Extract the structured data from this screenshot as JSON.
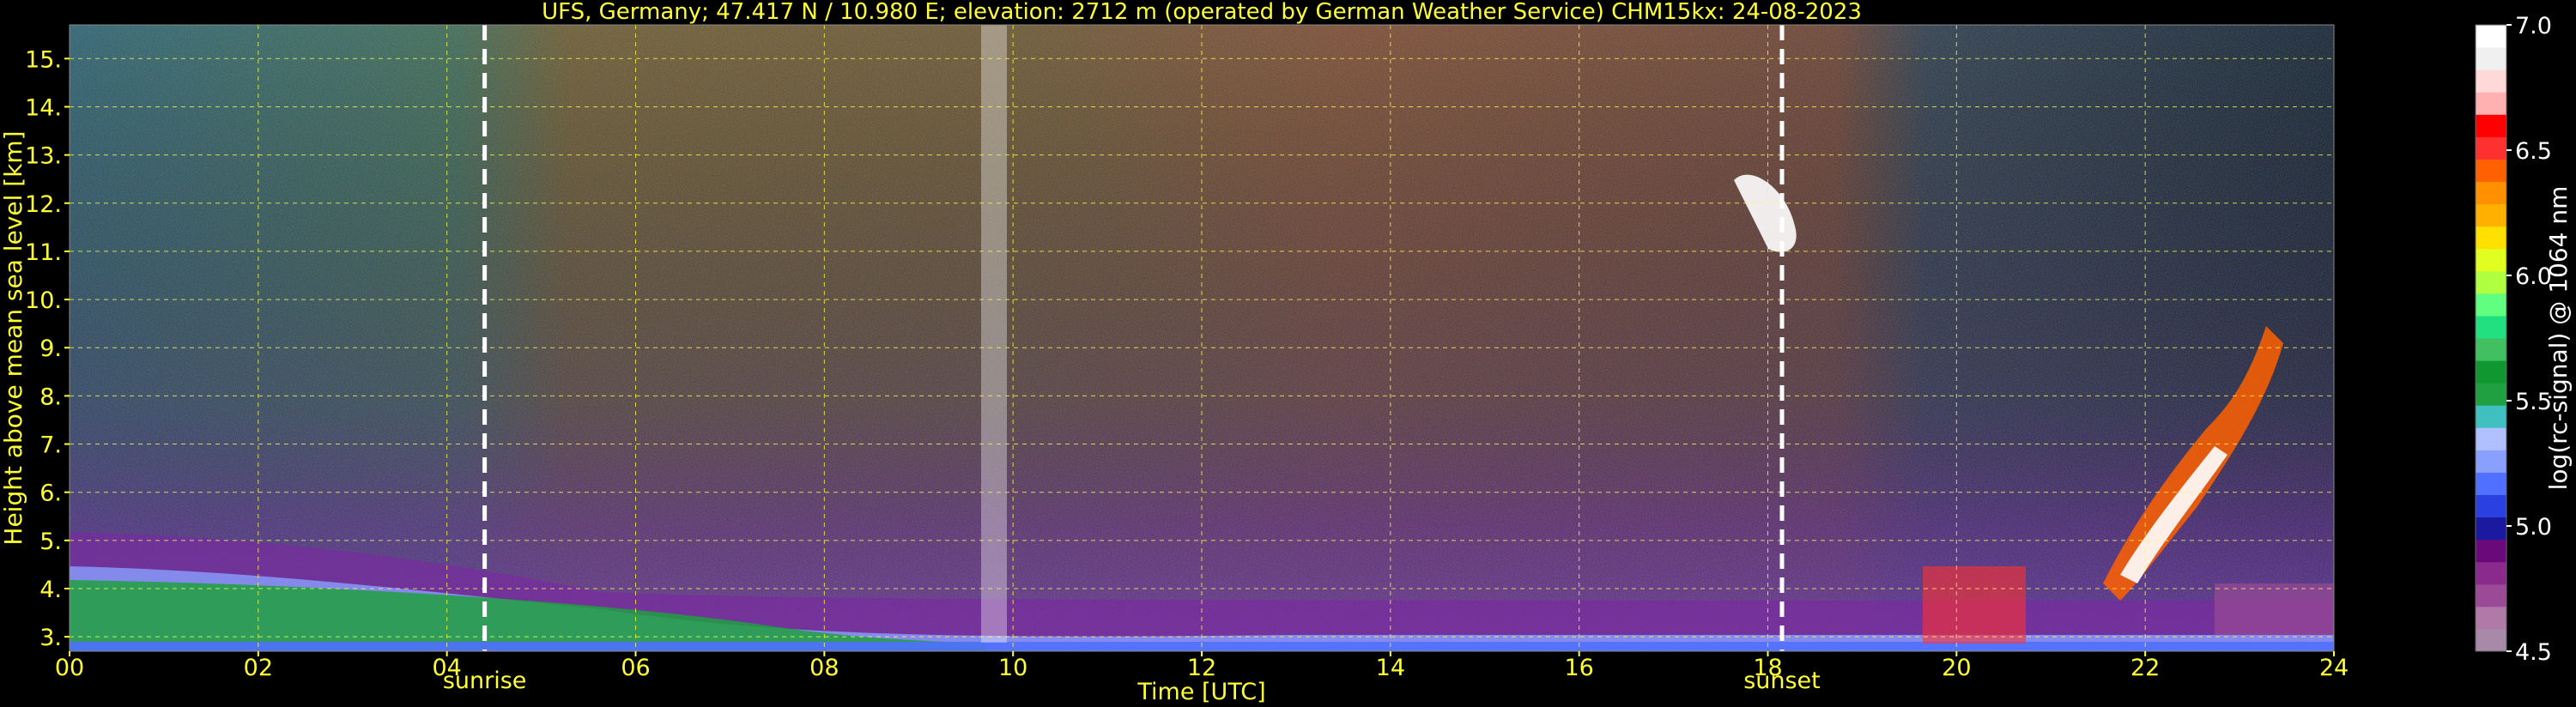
{
  "chart_data": {
    "type": "heatmap",
    "title": "UFS, Germany; 47.417 N / 10.980 E; elevation: 2712 m  (operated by German Weather Service)    CHM15kx: 24-08-2023",
    "xlabel": "Time [UTC]",
    "ylabel": "Height above mean sea level [km]",
    "xlim": [
      0,
      24
    ],
    "ylim": [
      2.7,
      15.7
    ],
    "x_ticks": [
      0,
      2,
      4,
      6,
      8,
      10,
      12,
      14,
      16,
      18,
      20,
      22,
      24
    ],
    "x_tick_labels": [
      "00",
      "02",
      "04",
      "06",
      "08",
      "10",
      "12",
      "14",
      "16",
      "18",
      "20",
      "22",
      "24"
    ],
    "y_ticks": [
      3,
      4,
      5,
      6,
      7,
      8,
      9,
      10,
      11,
      12,
      13,
      14,
      15
    ],
    "y_tick_labels": [
      "3.",
      "4.",
      "5.",
      "6.",
      "7.",
      "8.",
      "9.",
      "10.",
      "11.",
      "12.",
      "13.",
      "14.",
      "15."
    ],
    "grid": true,
    "markers": [
      {
        "label": "sunrise",
        "x": 4.4
      },
      {
        "label": "sunset",
        "x": 18.15
      }
    ],
    "colorbar": {
      "label": "log(rc-signal) @ 1064 nm",
      "min": 4.5,
      "max": 7.0,
      "ticks": [
        4.5,
        5.0,
        5.5,
        6.0,
        6.5,
        7.0
      ],
      "tick_labels": [
        "4.5",
        "5.0",
        "5.5",
        "6.0",
        "6.5",
        "7.0"
      ],
      "colors": [
        "#a88aa8",
        "#b07aa8",
        "#9a4a96",
        "#8a2a8c",
        "#6a0a7a",
        "#1a1aa0",
        "#2a40e0",
        "#5070ff",
        "#8aa0ff",
        "#b0c0ff",
        "#40c0c0",
        "#20a040",
        "#109830",
        "#40c060",
        "#20e080",
        "#60ff80",
        "#b0ff40",
        "#e0ff20",
        "#ffe000",
        "#ffb000",
        "#ff9000",
        "#ff6000",
        "#ff3030",
        "#ff0000",
        "#ffb0b0",
        "#ffd8d8",
        "#f0f0f0",
        "#ffffff"
      ]
    }
  }
}
